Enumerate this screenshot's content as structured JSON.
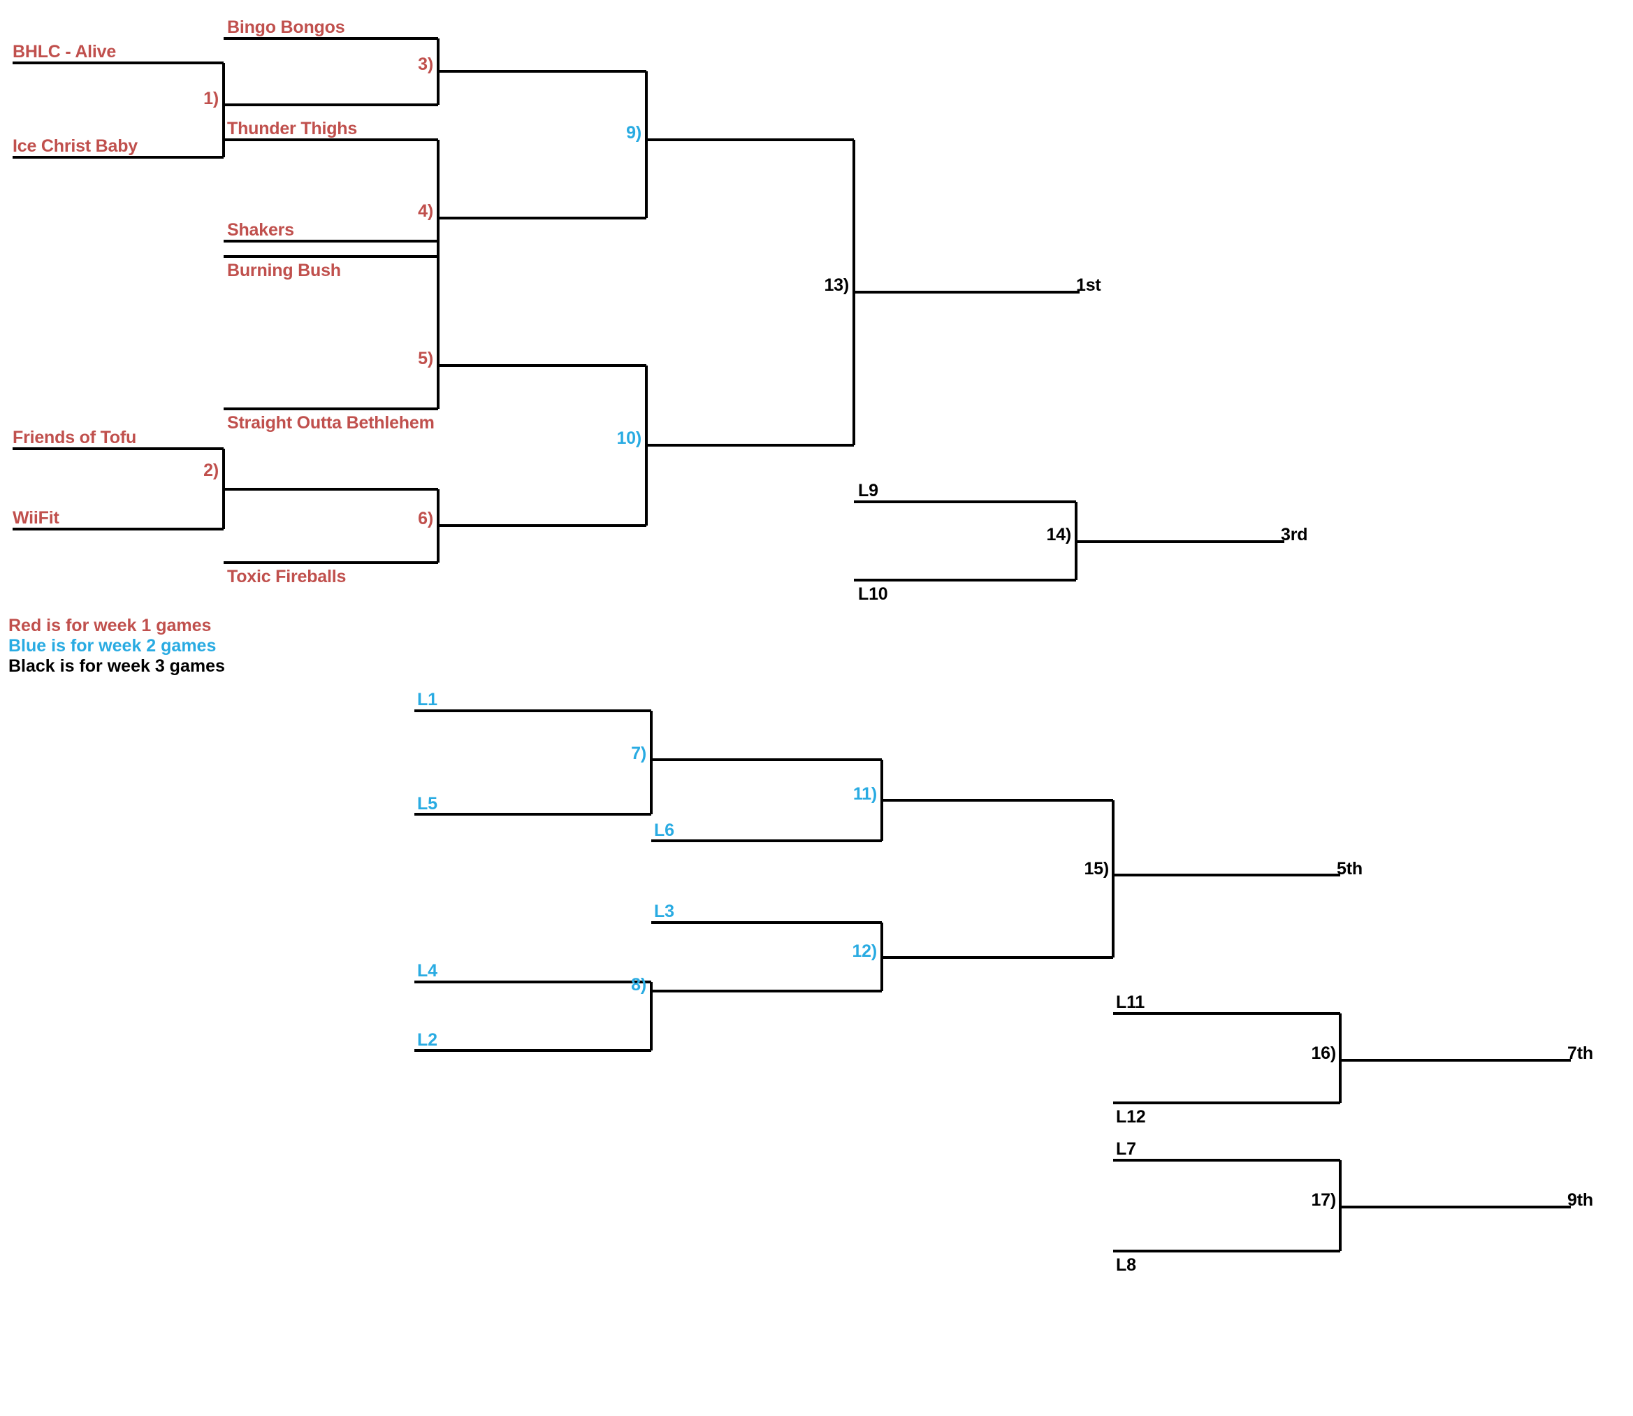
{
  "title": "Double Elimination Tournament Bracket",
  "colors": {
    "week1_red": "#C0504D",
    "week2_blue": "#29ABE2",
    "week3_black": "#000000",
    "line": "#000000",
    "background": "#FFFFFF"
  },
  "legend": {
    "line1": "Red is for week 1 games",
    "line2": "Blue is for week 2 games",
    "line3": "Black is for week 3 games"
  },
  "teams": {
    "bhlc_alive": "BHLC - Alive",
    "ice_christ_baby": "Ice Christ Baby",
    "bingo_bongos": "Bingo Bongos",
    "thunder_thighs": "Thunder Thighs",
    "burning_bush": "Burning Bush",
    "shakers": "Shakers",
    "straight_outta_bethlehem": "Straight Outta Bethlehem",
    "friends_of_tofu": "Friends of Tofu",
    "wiifit": "WiiFit",
    "toxic_fireballs": "Toxic Fireballs"
  },
  "winners_bracket": {
    "games": [
      {
        "id": "g1",
        "label": "1)",
        "week": "red",
        "slots": [
          "BHLC - Alive",
          "Ice Christ Baby"
        ]
      },
      {
        "id": "g3",
        "label": "3)",
        "week": "red",
        "slots": [
          "Bingo Bongos",
          "W1"
        ]
      },
      {
        "id": "g4",
        "label": "4)",
        "week": "red",
        "slots": [
          "Thunder Thighs",
          "Burning Bush"
        ]
      },
      {
        "id": "g5",
        "label": "5)",
        "week": "red",
        "slots": [
          "Shakers",
          "Straight Outta Bethlehem"
        ]
      },
      {
        "id": "g2",
        "label": "2)",
        "week": "red",
        "slots": [
          "Friends of Tofu",
          "WiiFit"
        ]
      },
      {
        "id": "g6",
        "label": "6)",
        "week": "red",
        "slots": [
          "W2",
          "Toxic Fireballs"
        ]
      },
      {
        "id": "g9",
        "label": "9)",
        "week": "blue",
        "slots": [
          "W3",
          "W4"
        ]
      },
      {
        "id": "g10",
        "label": "10)",
        "week": "blue",
        "slots": [
          "W5",
          "W6"
        ]
      },
      {
        "id": "g13",
        "label": "13)",
        "week": "black",
        "slots": [
          "W9",
          "W10"
        ]
      }
    ],
    "final_placement": "1st"
  },
  "third_place_bracket": {
    "game": {
      "id": "g14",
      "label": "14)",
      "week": "black",
      "slots": [
        "L9",
        "L10"
      ]
    },
    "slot_top": "L9",
    "slot_bottom": "L10",
    "placement": "3rd"
  },
  "losers_bracket": {
    "games": [
      {
        "id": "g7",
        "label": "7)",
        "week": "blue",
        "slot_top": "L1",
        "slot_bottom": "L5"
      },
      {
        "id": "g11",
        "label": "11)",
        "week": "blue",
        "slot_top": "W7",
        "slot_bottom": "L6"
      },
      {
        "id": "g8",
        "label": "8)",
        "week": "blue",
        "slot_top": "L4",
        "slot_bottom": "L2"
      },
      {
        "id": "g12",
        "label": "12)",
        "week": "blue",
        "slot_top": "L3",
        "slot_bottom": "W8"
      },
      {
        "id": "g15",
        "label": "15)",
        "week": "black",
        "slot_top": "W11",
        "slot_bottom": "W12"
      }
    ],
    "slot_l1": "L1",
    "slot_l5": "L5",
    "slot_l6": "L6",
    "slot_l3": "L3",
    "slot_l4": "L4",
    "slot_l2": "L2",
    "placement_5th": "5th"
  },
  "seventh_place_bracket": {
    "game": {
      "id": "g16",
      "label": "16)",
      "week": "black"
    },
    "slot_top": "L11",
    "slot_bottom": "L12",
    "placement": "7th"
  },
  "ninth_place_bracket": {
    "game": {
      "id": "g17",
      "label": "17)",
      "week": "black"
    },
    "slot_top": "L7",
    "slot_bottom": "L8",
    "placement": "9th"
  },
  "game_labels": {
    "g1": "1)",
    "g2": "2)",
    "g3": "3)",
    "g4": "4)",
    "g5": "5)",
    "g6": "6)",
    "g7": "7)",
    "g8": "8)",
    "g9": "9)",
    "g10": "10)",
    "g11": "11)",
    "g12": "12)",
    "g13": "13)",
    "g14": "14)",
    "g15": "15)",
    "g16": "16)",
    "g17": "17)"
  },
  "placements": {
    "first": "1st",
    "third": "3rd",
    "fifth": "5th",
    "seventh": "7th",
    "ninth": "9th"
  }
}
